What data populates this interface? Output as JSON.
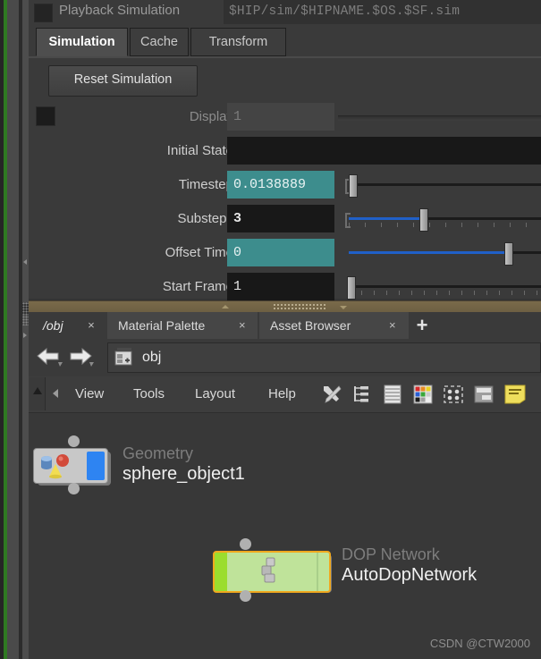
{
  "left_strip": {
    "accent_color": "#2f7a22"
  },
  "parameters": {
    "playback": {
      "checkbox_label": "playback-toggle",
      "label": "Playback Simulation",
      "path_value": "$HIP/sim/$HIPNAME.$OS.$SF.sim"
    },
    "tabs": [
      {
        "label": "Simulation",
        "active": true
      },
      {
        "label": "Cache",
        "active": false
      },
      {
        "label": "Transform",
        "active": false
      }
    ],
    "reset_button": "Reset Simulation",
    "rows": [
      {
        "label": "Display",
        "value": "1",
        "style": "grey",
        "has_checkbox": true
      },
      {
        "label": "Initial State",
        "value": "",
        "style": "dark",
        "has_checkbox": false
      },
      {
        "label": "Timestep",
        "value": "0.0138889",
        "style": "teal",
        "has_checkbox": false
      },
      {
        "label": "Substeps",
        "value": "3",
        "style": "dark",
        "has_checkbox": false
      },
      {
        "label": "Offset Time",
        "value": "0",
        "style": "teal",
        "has_checkbox": false
      },
      {
        "label": "Start Frame",
        "value": "1",
        "style": "dark",
        "has_checkbox": false
      }
    ]
  },
  "network": {
    "tabs": [
      {
        "label": "/obj",
        "active": true,
        "close": "×"
      },
      {
        "label": "Material Palette",
        "active": false,
        "close": "×"
      },
      {
        "label": "Asset Browser",
        "active": false,
        "close": "×"
      }
    ],
    "add_tab": "+",
    "nav": {
      "back_icon": "back-arrow-icon",
      "forward_icon": "forward-arrow-icon",
      "breadcrumb_icon": "network-node-icon",
      "breadcrumb_text": "obj"
    },
    "toolbar": {
      "menus": [
        "View",
        "Tools",
        "Layout",
        "Help"
      ],
      "icons": [
        "tools-icon",
        "tree-list-icon",
        "list-layers-icon",
        "color-palette-icon",
        "node-layout-icon",
        "dock-panel-icon",
        "notes-icon"
      ]
    },
    "nodes": [
      {
        "type": "Geometry",
        "name": "sphere_object1"
      },
      {
        "type": "DOP Network",
        "name": "AutoDopNetwork"
      }
    ]
  },
  "watermark": "CSDN @CTW2000"
}
